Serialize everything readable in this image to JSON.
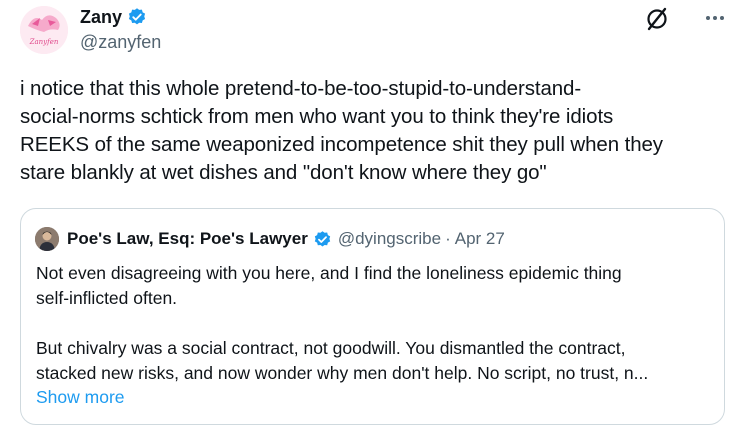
{
  "author": {
    "display_name": "Zany",
    "handle": "@zanyfen",
    "avatar_text": "Zanyfen"
  },
  "header_icons": [
    "grok-icon",
    "more-icon"
  ],
  "tweet": {
    "text": "i notice that this whole pretend-to-be-too-stupid-to-understand-\nsocial-norms schtick from men who want you to think they're idiots\nREEKS of the same weaponized incompetence shit they pull when they\nstare blankly at wet dishes and \"don't know where they go\""
  },
  "quoted": {
    "display_name": "Poe's Law, Esq: Poe's Lawyer",
    "handle": "@dyingscribe",
    "separator": "·",
    "date": "Apr 27",
    "text": "Not even disagreeing with you here, and I find the loneliness epidemic thing\nself-inflicted often.\n\nBut chivalry was a social contract, not goodwill. You dismantled the contract,\nstacked new risks, and now wonder why men don't help. No script, no trust, n...",
    "show_more": "Show more"
  },
  "colors": {
    "text": "#0f1419",
    "secondary": "#536471",
    "accent": "#1d9bf0",
    "border": "#cfd9de"
  }
}
